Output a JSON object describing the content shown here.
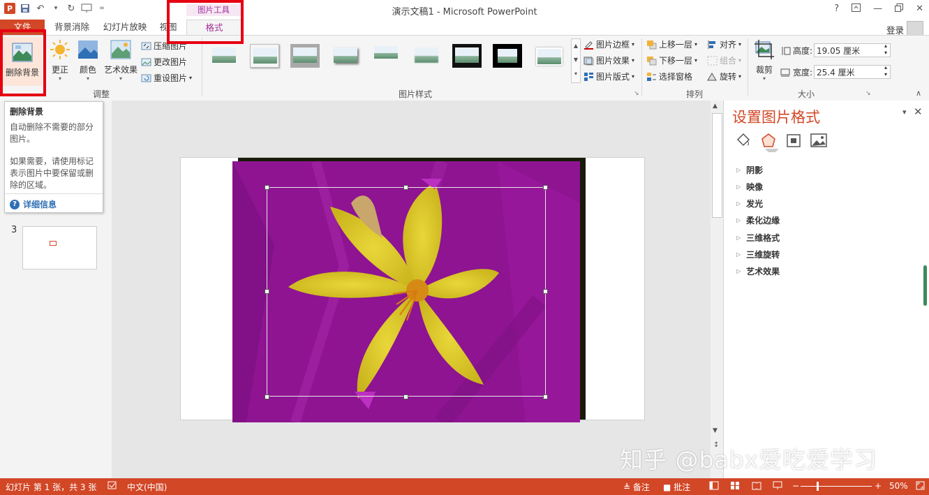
{
  "window": {
    "title": "演示文稿1 - Microsoft PowerPoint",
    "help_icon": "?",
    "user_login": "登录"
  },
  "tabs": {
    "file": "文件",
    "items": [
      "背景消除",
      "幻灯片放映",
      "视图"
    ],
    "context_group": "图片工具",
    "active": "格式"
  },
  "ribbon": {
    "adjust": {
      "label": "调整",
      "remove_bg": "删除背景",
      "correct": "更正",
      "color": "颜色",
      "artistic": "艺术效果",
      "compress": "压缩图片",
      "change": "更改图片",
      "reset": "重设图片"
    },
    "styles": {
      "label": "图片样式",
      "border": "图片边框",
      "effects": "图片效果",
      "layout": "图片版式"
    },
    "arrange": {
      "label": "排列",
      "forward": "上移一层",
      "backward": "下移一层",
      "selection": "选择窗格",
      "align": "对齐",
      "group": "组合",
      "rotate": "旋转"
    },
    "size": {
      "label": "大小",
      "crop": "裁剪",
      "height_label": "高度:",
      "height_value": "19.05 厘米",
      "width_label": "宽度:",
      "width_value": "25.4 厘米"
    }
  },
  "tooltip": {
    "title": "删除背景",
    "line1": "自动删除不需要的部分图片。",
    "line2": "如果需要，请使用标记表示图片中要保留或删除的区域。",
    "more": "详细信息"
  },
  "thumbs": {
    "slide_number": "3"
  },
  "format_pane": {
    "title": "设置图片格式",
    "items": [
      "阴影",
      "映像",
      "发光",
      "柔化边缘",
      "三维格式",
      "三维旋转",
      "艺术效果"
    ]
  },
  "status": {
    "slide_info": "幻灯片 第 1 张，共 3 张",
    "language": "中文(中国)",
    "notes": "备注",
    "comments": "批注",
    "zoom": "50%"
  },
  "watermark": "知乎 @babx爱吃爱学习",
  "colors": {
    "accent": "#d24726",
    "context": "#a3309b",
    "highlight": "#e60012",
    "removed_overlay": "#8e1492"
  }
}
